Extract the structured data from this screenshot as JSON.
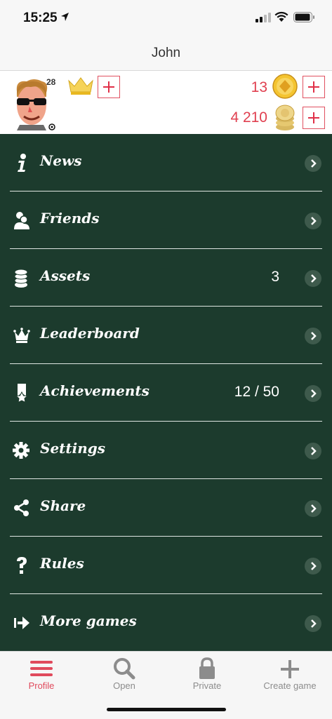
{
  "status": {
    "time": "15:25"
  },
  "header": {
    "title": "John"
  },
  "profile": {
    "level": "28",
    "gems": "13",
    "chips": "4 210"
  },
  "menu": {
    "items": [
      {
        "label": "News",
        "value": "",
        "icon": "info-icon"
      },
      {
        "label": "Friends",
        "value": "",
        "icon": "friends-icon"
      },
      {
        "label": "Assets",
        "value": "3",
        "icon": "coins-stack-icon"
      },
      {
        "label": "Leaderboard",
        "value": "",
        "icon": "crown-icon"
      },
      {
        "label": "Achievements",
        "value": "12 / 50",
        "icon": "award-ribbon-icon"
      },
      {
        "label": "Settings",
        "value": "",
        "icon": "gear-icon"
      },
      {
        "label": "Share",
        "value": "",
        "icon": "share-icon"
      },
      {
        "label": "Rules",
        "value": "",
        "icon": "question-icon"
      },
      {
        "label": "More games",
        "value": "",
        "icon": "more-games-arrow-icon"
      }
    ]
  },
  "tabbar": {
    "tabs": [
      {
        "label": "Profile",
        "icon": "menu-icon",
        "active": true
      },
      {
        "label": "Open",
        "icon": "search-icon",
        "active": false
      },
      {
        "label": "Private",
        "icon": "lock-icon",
        "active": false
      },
      {
        "label": "Create game",
        "icon": "plus-icon",
        "active": false
      }
    ]
  },
  "colors": {
    "menu_background": "#1c3b2d",
    "accent_red": "#e04a5c",
    "gold": "#e8b820"
  }
}
